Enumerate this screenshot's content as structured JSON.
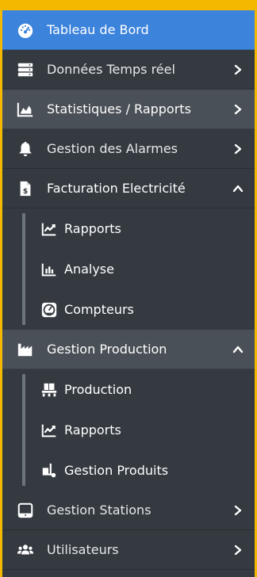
{
  "menu": {
    "dashboard": "Tableau de Bord",
    "realtime": "Données Temps réel",
    "statistics": "Statistiques / Rapports",
    "alarms": "Gestion des Alarmes",
    "billing": "Facturation Electricité",
    "billing_sub": {
      "reports": "Rapports",
      "analysis": "Analyse",
      "meters": "Compteurs"
    },
    "production": "Gestion Production",
    "production_sub": {
      "production": "Production",
      "reports": "Rapports",
      "products": "Gestion Produits"
    },
    "stations": "Gestion Stations",
    "users": "Utilisateurs"
  },
  "colors": {
    "sidebar_bg": "#343a40",
    "active_bg": "#3c83dc",
    "frame": "#f5b800",
    "hover_bg": "#4a5057"
  },
  "icons": {
    "dashboard": "tachometer-icon",
    "realtime": "server-icon",
    "statistics": "area-chart-icon",
    "alarms": "bell-icon",
    "billing": "invoice-dollar-icon",
    "billing_reports": "line-chart-icon",
    "billing_analysis": "bar-chart-icon",
    "billing_meters": "gauge-icon",
    "production": "industry-icon",
    "production_production": "pallet-icon",
    "production_reports": "line-chart-icon",
    "production_products": "dolly-icon",
    "stations": "tablet-icon",
    "users": "users-icon"
  }
}
